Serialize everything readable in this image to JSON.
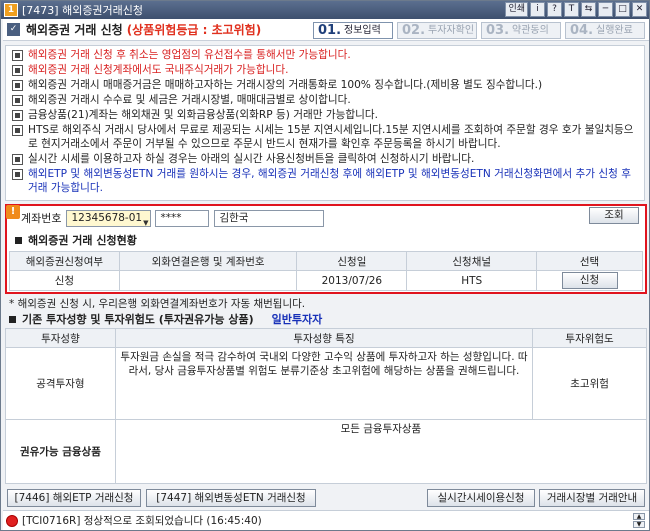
{
  "window": {
    "title": "[7473] 해외증권거래신청",
    "tools": [
      "인쇄",
      "i",
      "?",
      "T",
      "⇆",
      "─",
      "□",
      "✕"
    ]
  },
  "header": {
    "title": "해외증권 거래 신청",
    "risk": "(상품위험등급 : 초고위험)",
    "steps": [
      {
        "num": "01.",
        "label": "정보입력"
      },
      {
        "num": "02.",
        "label": "투자자확인"
      },
      {
        "num": "03.",
        "label": "약관동의"
      },
      {
        "num": "04.",
        "label": "실행완료"
      }
    ]
  },
  "notices": [
    {
      "text": "해외증권 거래 신청 후 취소는 영업점의 유선접수를 통해서만 가능합니다.",
      "color": "red"
    },
    {
      "text": "해외증권 거래 신청계좌에서도 국내주식거래가 가능합니다.",
      "color": "red"
    },
    {
      "text": "해외증권 거래시 매매증거금은 매매하고자하는 거래시장의 거래통화로 100% 징수합니다.(제비용 별도 징수합니다.)",
      "color": "dark"
    },
    {
      "text": "해외증권 거래시 수수료 및 세금은 거래시장별, 매매대금별로 상이합니다.",
      "color": "dark"
    },
    {
      "text": "금융상품(21)계좌는 해외채권 및 외화금융상품(외화RP 등) 거래만 가능합니다.",
      "color": "dark"
    },
    {
      "text": "HTS로 해외주식 거래시 당사에서 무료로 제공되는 시세는 15분 지연시세입니다.15분 지연시세를 조회하여 주문할 경우 호가 불일치등으로 현지거래소에서 주문이 거부될 수 있으므로 주문시 반드시 현재가를 확인후 주문등록을 하시기 바랍니다.",
      "color": "dark"
    },
    {
      "text": "실시간 시세를 이용하고자 하실 경우는 아래의 실시간 사용신청버튼을 클릭하여 신청하시기 바랍니다.",
      "color": "dark"
    },
    {
      "text": "해외ETP 및 해외변동성ETN 거래를 원하시는 경우, 해외증권 거래신청 후에 해외ETP 및 해외변동성ETN 거래신청화면에서 추가 신청 후 거래 가능합니다.",
      "color": "blue"
    }
  ],
  "account": {
    "badge": "!",
    "label": "계좌번호",
    "number": "12345678-01",
    "password": "****",
    "name": "김한국",
    "query_label": "조회"
  },
  "status": {
    "title": "해외증권 거래 신청현황",
    "columns": [
      "해외증권신청여부",
      "외화연결은행 및 계좌번호",
      "신청일",
      "신청채널",
      "선택"
    ],
    "row": {
      "applied": "신청",
      "bank_account": "",
      "date": "2013/07/26",
      "channel": "HTS",
      "action": "신청"
    }
  },
  "note": "* 해외증권 신청 시, 우리은행 외화연결계좌번호가 자동 채번됩니다.",
  "investor": {
    "title": "기존 투자성향 및 투자위험도 (투자권유가능 상품)",
    "type": "일반투자자",
    "columns": [
      "투자성향",
      "투자성향 특징",
      "투자위험도"
    ],
    "row1": {
      "profile": "공격투자형",
      "desc": "투자원금 손실을 적극 감수하여 국내외 다양한 고수익 상품에 투자하고자 하는 성향입니다. 따라서, 당사 금융투자상품별 위험도 분류기준상 초고위험에 해당하는 상품을 권해드립니다.",
      "risk": "초고위험"
    },
    "row2": {
      "label": "권유가능 금융상품",
      "value": "모든 금융투자상품"
    }
  },
  "buttons": {
    "etp": "[7446] 해외ETP 거래신청",
    "etn": "[7447] 해외변동성ETN 거래신청",
    "realtime": "실시간시세이용신청",
    "market_guide": "거래시장별 거래안내"
  },
  "statusbar": {
    "message": "[TCI0716R] 정상적으로 조회되었습니다 (16:45:40)"
  }
}
